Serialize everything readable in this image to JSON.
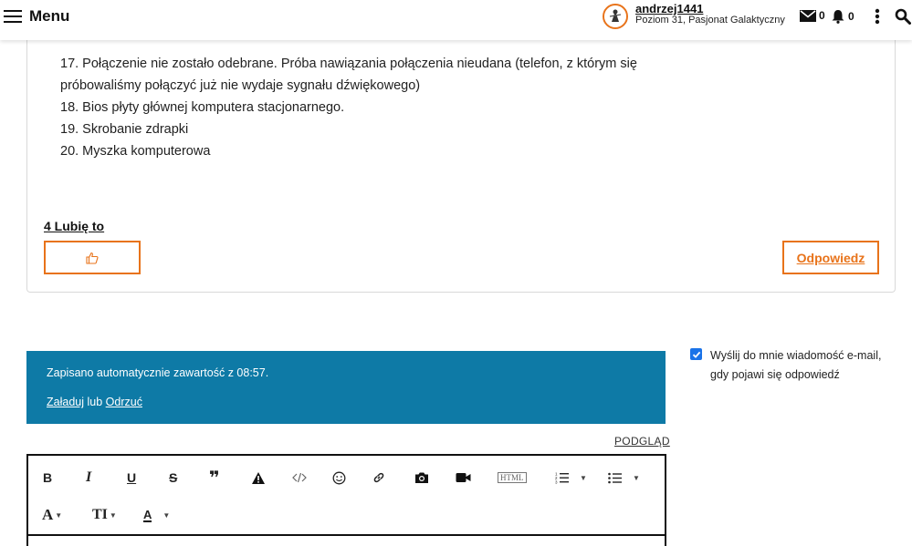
{
  "header": {
    "menu_label": "Menu",
    "username": "andrzej1441",
    "rank": "Poziom 31, Pasjonat Galaktyczny",
    "mail_count": "0",
    "notif_count": "0"
  },
  "post": {
    "list": [
      "17. Połączenie nie zostało odebrane. Próba nawiązania połączenia nieudana (telefon, z którym się",
      "próbowaliśmy połączyć już nie wydaje sygnału dźwiękowego)",
      "18. Bios płyty głównej komputera stacjonarnego.",
      "19. Skrobanie zdrapki",
      "20. Myszka komputerowa"
    ],
    "likes": "4 Lubię to",
    "reply_label": "Odpowiedz"
  },
  "autosave": {
    "message": "Zapisano automatycznie zawartość z 08:57.",
    "load_label": "Załaduj",
    "or_label": "lub",
    "discard_label": "Odrzuć"
  },
  "email_option": {
    "label": "Wyślij do mnie wiadomość e-mail, gdy pojawi się odpowiedź",
    "checked": true
  },
  "preview_label": "PODGLĄD",
  "toolbar": {
    "bold": "B",
    "italic": "I",
    "underline": "U",
    "strike": "S",
    "quote": "❞",
    "html": "HTML",
    "font": "A",
    "size": "TI",
    "color": "A"
  },
  "colors": {
    "accent": "#e8731a",
    "banner": "#0e7aa6",
    "checkbox": "#1a73e8"
  }
}
